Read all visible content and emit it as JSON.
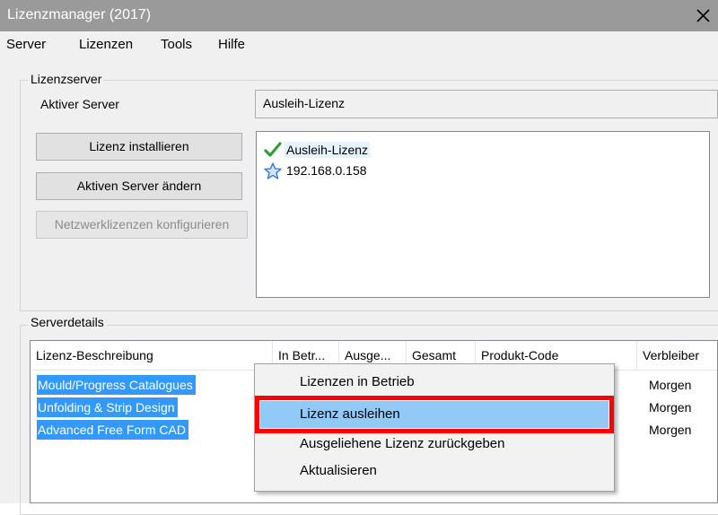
{
  "window": {
    "title": "Lizenzmanager (2017)"
  },
  "menu": [
    "Server",
    "Lizenzen",
    "Tools",
    "Hilfe"
  ],
  "license_server": {
    "group_label": "Lizenzserver",
    "active_server_label": "Aktiver Server",
    "active_server_value": "Ausleih-Lizenz",
    "buttons": {
      "install": "Lizenz installieren",
      "change": "Aktiven Server ändern",
      "configure": "Netzwerklizenzen konfigurieren"
    },
    "servers": [
      {
        "label": "Ausleih-Lizenz",
        "icon": "checkmark-icon",
        "selected": true
      },
      {
        "label": "192.168.0.158",
        "icon": "star-icon",
        "selected": false
      }
    ]
  },
  "server_details": {
    "group_label": "Serverdetails",
    "columns": [
      "Lizenz-Beschreibung",
      "In Betr...",
      "Ausge...",
      "Gesamt",
      "Produkt-Code",
      "Verbleiber"
    ],
    "rows": [
      {
        "description": "Mould/Progress Catalogues",
        "remaining": "Morgen"
      },
      {
        "description": "Unfolding & Strip Design",
        "remaining": "Morgen"
      },
      {
        "description": "Advanced Free Form CAD",
        "remaining": "Morgen"
      }
    ]
  },
  "context_menu": {
    "items": [
      {
        "label": "Lizenzen in Betrieb",
        "highlighted": false
      },
      {
        "label": "Lizenz ausleihen",
        "highlighted": true
      },
      {
        "label": "Ausgeliehene Lizenz zurückgeben",
        "highlighted": false
      },
      {
        "label": "Aktualisieren",
        "highlighted": false
      }
    ]
  },
  "colors": {
    "selection": "#3399ff",
    "menu_hover": "#91c9f7",
    "annotation": "#ff0000",
    "titlebar": "#9a9a9a"
  }
}
